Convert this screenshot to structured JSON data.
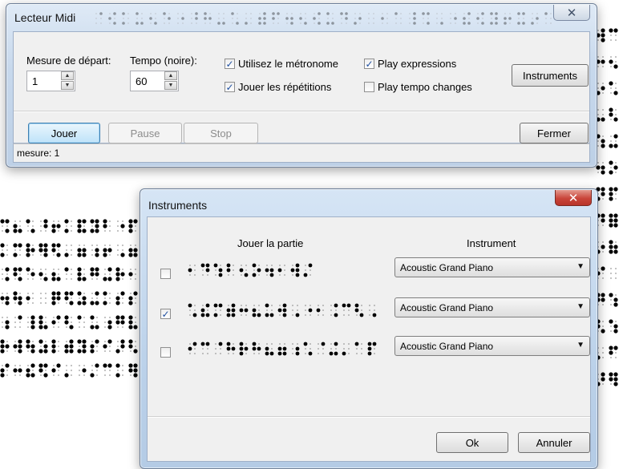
{
  "midi_window": {
    "title": "Lecteur Midi",
    "close_glyph": "✕",
    "start_measure_label": "Mesure de départ:",
    "start_measure_value": "1",
    "tempo_label": "Tempo (noire):",
    "tempo_value": "60",
    "metronome_label": "Utilisez le métronome",
    "metronome_checked": true,
    "repeats_label": "Jouer les répétitions",
    "repeats_checked": true,
    "expressions_label": "Play expressions",
    "expressions_checked": true,
    "tempo_changes_label": "Play tempo changes",
    "tempo_changes_checked": false,
    "instruments_button": "Instruments",
    "play_button": "Jouer",
    "pause_button": "Pause",
    "stop_button": "Stop",
    "close_button": "Fermer",
    "status_text": "mesure: 1"
  },
  "instruments_dialog": {
    "title": "Instruments",
    "close_glyph": "✕",
    "col_play_part": "Jouer la partie",
    "col_instrument": "Instrument",
    "rows": [
      {
        "checked": false,
        "instrument": "Acoustic Grand Piano"
      },
      {
        "checked": true,
        "instrument": "Acoustic Grand Piano"
      },
      {
        "checked": false,
        "instrument": "Acoustic Grand Piano"
      }
    ],
    "ok_button": "Ok",
    "cancel_button": "Annuler"
  },
  "icons": {
    "spin_up": "up-arrow-icon",
    "spin_down": "down-arrow-icon",
    "dropdown": "chevron-down-icon",
    "checkmark": "checkmark-icon"
  },
  "colors": {
    "title_bar_glass": "#c9dbee",
    "close_red": "#c9453a",
    "primary_button": "#bfe3f9",
    "dialog_bg": "#f0f0f0"
  }
}
